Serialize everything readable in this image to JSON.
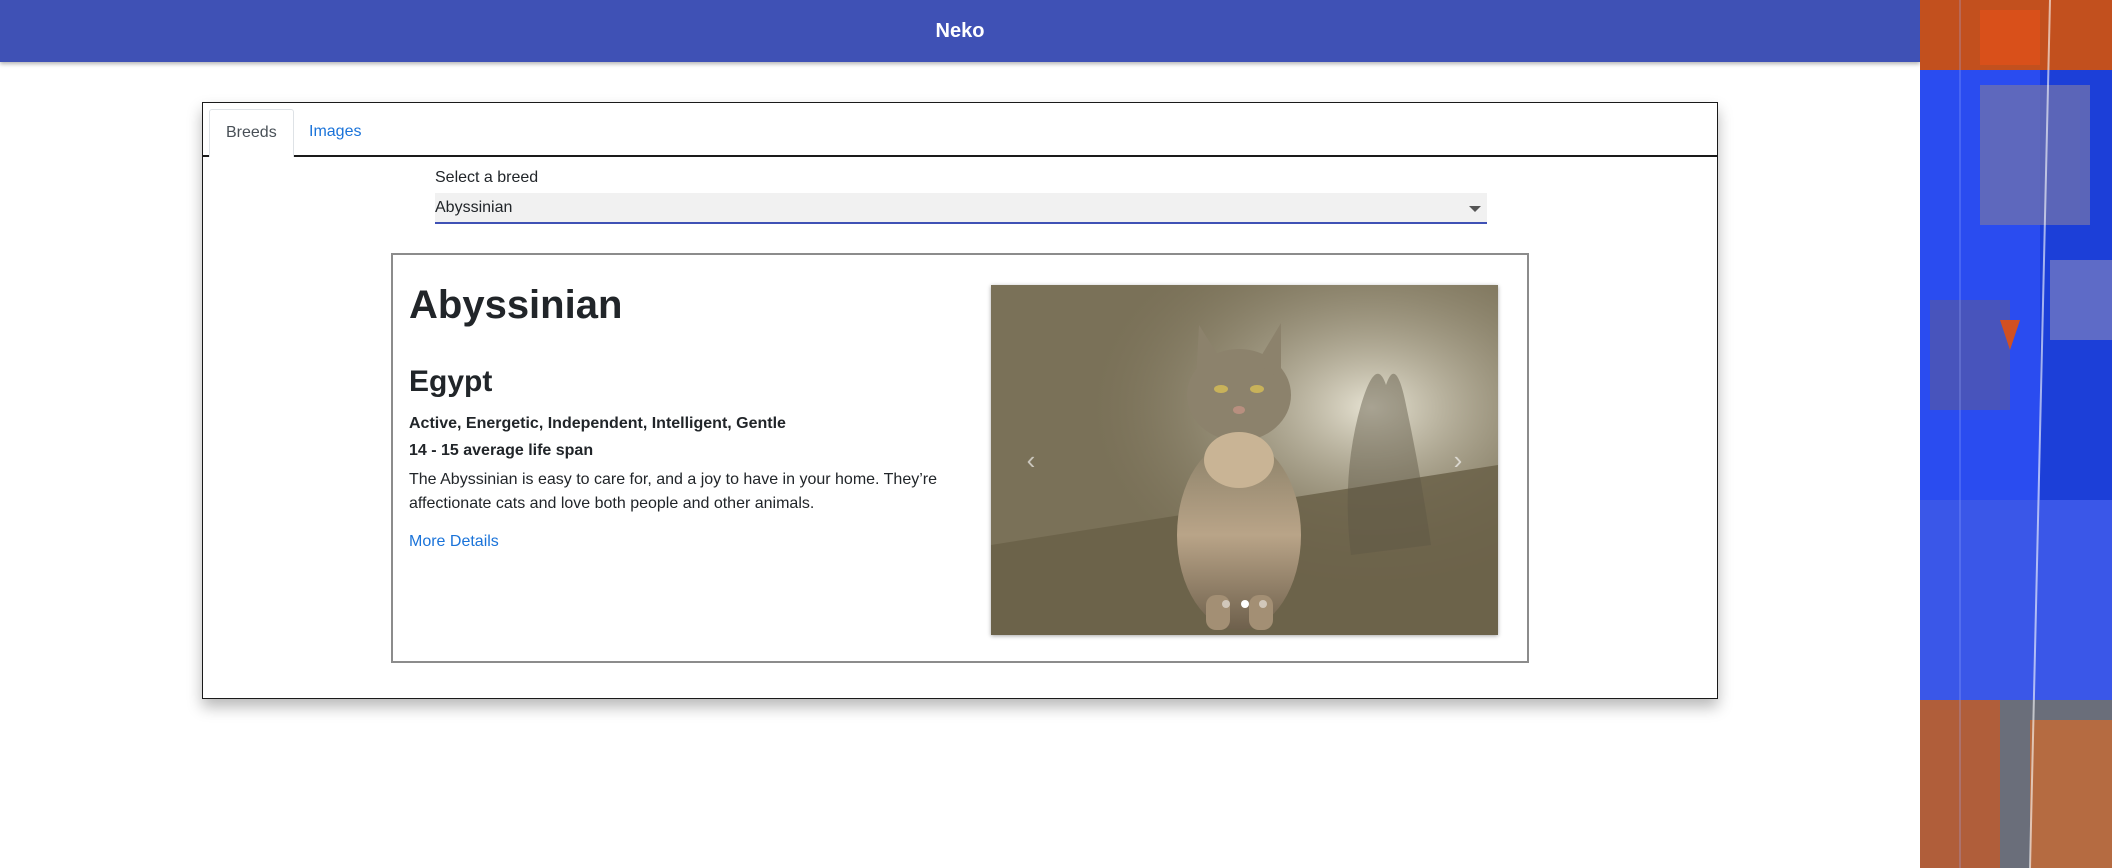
{
  "app": {
    "title": "Neko"
  },
  "tabs": [
    {
      "label": "Breeds",
      "active": true
    },
    {
      "label": "Images",
      "active": false
    }
  ],
  "breed_select": {
    "label": "Select a breed",
    "value": "Abyssinian"
  },
  "breed": {
    "name": "Abyssinian",
    "origin": "Egypt",
    "temperament": "Active, Energetic, Independent, Intelligent, Gentle",
    "life_span": "14 - 15 average life span",
    "description": "The Abyssinian is easy to care for, and a joy to have in your home. They’re affectionate cats and love both people and other animals.",
    "details_link": "More Details"
  },
  "carousel": {
    "prev_icon": "chevron-left-icon",
    "next_icon": "chevron-right-icon",
    "slide_count": 3,
    "active_slide": 2
  },
  "colors": {
    "appbar": "#3f51b5",
    "link": "#1a73d9",
    "select_underline": "#3f51b5"
  }
}
